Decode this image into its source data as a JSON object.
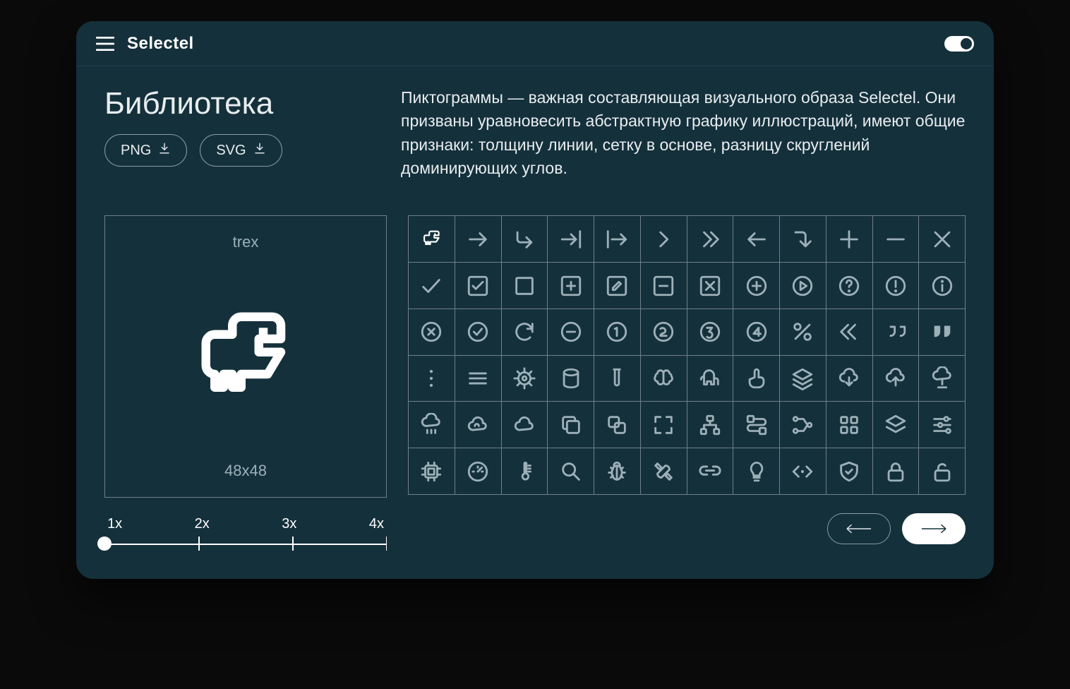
{
  "brand": "Selectel",
  "page": {
    "title": "Библиотека",
    "download_png": "PNG",
    "download_svg": "SVG",
    "description": "Пиктограммы — важная составляющая визуального образа Selectel. Они призваны уравновесить абстрактную графику иллюстраций, имеют общие признаки: толщину линии, сетку в основе, разницу скруглений доминирующих углов."
  },
  "preview": {
    "name": "trex",
    "size": "48x48"
  },
  "zoom": {
    "labels": [
      "1x",
      "2x",
      "3x",
      "4x"
    ],
    "value": 1
  },
  "icons": [
    "trex",
    "arrow-right",
    "corner-down-right",
    "arrow-to-right",
    "arrow-from-left",
    "chevron-right",
    "chevrons-right",
    "arrow-left",
    "corner-right-down",
    "plus",
    "minus",
    "x",
    "check",
    "checkbox-checked",
    "square",
    "square-plus",
    "square-edit",
    "square-minus",
    "square-x",
    "circle-plus",
    "circle-play",
    "circle-question",
    "circle-exclamation",
    "circle-info",
    "circle-x",
    "circle-check",
    "refresh",
    "circle-minus",
    "circle-1",
    "circle-2",
    "circle-3",
    "circle-4",
    "percent",
    "chevrons-left",
    "quote-outline",
    "quote-fill",
    "dots-vertical",
    "menu",
    "ship-wheel",
    "cylinder",
    "test-tube",
    "brain",
    "elephant",
    "hand-point",
    "layers",
    "cloud-down",
    "cloud-up",
    "cloud-connect",
    "cloud-rain",
    "cloud-outline",
    "cloud",
    "copy",
    "overlap",
    "fullscreen",
    "sitemap",
    "route",
    "nodes",
    "grid-dots",
    "stack",
    "sliders",
    "cpu",
    "gauge",
    "thermometer",
    "search",
    "bug",
    "tools",
    "link",
    "bulb",
    "code",
    "shield-check",
    "lock",
    "unlock"
  ],
  "selected_icon": "trex"
}
